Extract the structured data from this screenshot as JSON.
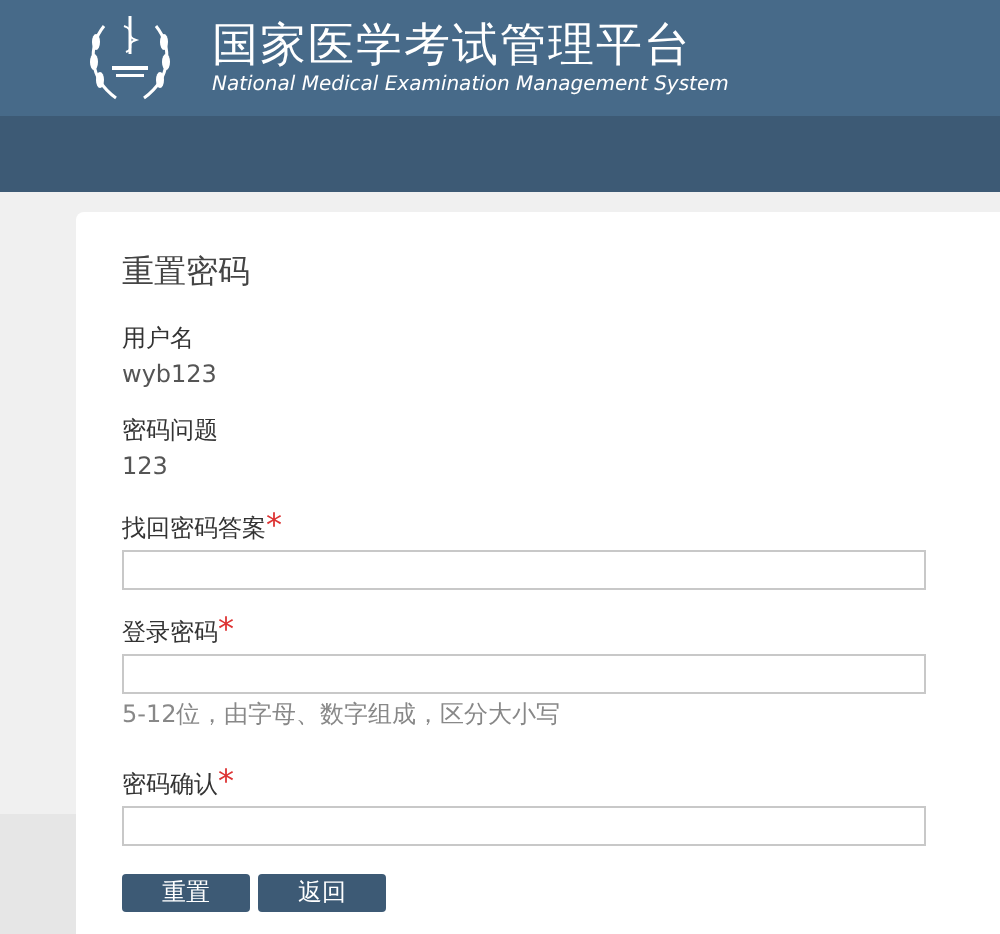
{
  "header": {
    "title": "国家医学考试管理平台",
    "subtitle": "National Medical Examination Management System"
  },
  "form": {
    "title": "重置密码",
    "fields": [
      {
        "kind": "static",
        "label": "用户名",
        "value": "wyb123"
      },
      {
        "kind": "static",
        "label": "密码问题",
        "value": "123"
      },
      {
        "kind": "input",
        "label": "找回密码答案",
        "required_mark": "*"
      },
      {
        "kind": "input",
        "label": "登录密码",
        "required_mark": "*",
        "hint": "5-12位，由字母、数字组成，区分大小写"
      },
      {
        "kind": "input",
        "label": "密码确认",
        "required_mark": "*"
      }
    ],
    "buttons": [
      "重置",
      "返回"
    ]
  }
}
